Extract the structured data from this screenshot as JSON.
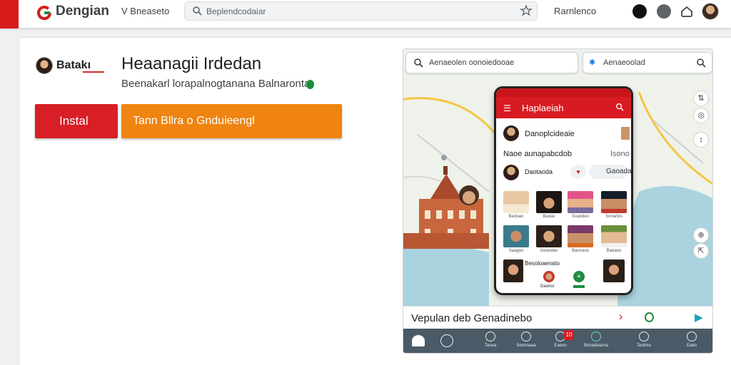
{
  "topbar": {
    "brand": "Dengian",
    "dropdown_label": "V Bneaseto",
    "search_placeholder": "Beplendcodaiar",
    "link_label": "Rarnlenco",
    "brand_color": "#d81b1b"
  },
  "app": {
    "short_name": "Batakı",
    "title": "Heaanagii Irdedan",
    "developer_line": "Beenakarl lorapalnogtanana Balnaronta",
    "install_label": "Instal",
    "secondary_label": "Tann Bllra o Gnduieengl",
    "install_color": "#d81f26",
    "secondary_color": "#ef8410"
  },
  "preview": {
    "map_search_left": "Aenaeolen oonoiedooae",
    "map_search_right": "Aenaeoolad",
    "phone_title": "Haplaeiah",
    "row1_name": "Danoplcideaie",
    "row2_label": "Naoe aunapabcdob",
    "row2_right": "Isono",
    "row3_name": "Daotaoda",
    "row3_pill": "Gaoadap",
    "faces": [
      {
        "caption": "Bedoan"
      },
      {
        "caption": "Badae"
      },
      {
        "caption": "Soandeo"
      },
      {
        "caption": "Sonarbis"
      },
      {
        "caption": "Saagon"
      },
      {
        "caption": "Geaodao"
      },
      {
        "caption": "Baonaoo"
      },
      {
        "caption": "Baeaeo"
      }
    ],
    "row_last_label": "Besoloaenato",
    "row_last_caption": "Daonoi",
    "bottom_title": "Vepulan deb Genadinebo",
    "nav_items": [
      "Teoea",
      "Sennnaaa",
      "Eaeoo",
      "Bonadeaona",
      "Teotmo",
      "Eaeo"
    ],
    "nav_badge": "10"
  }
}
